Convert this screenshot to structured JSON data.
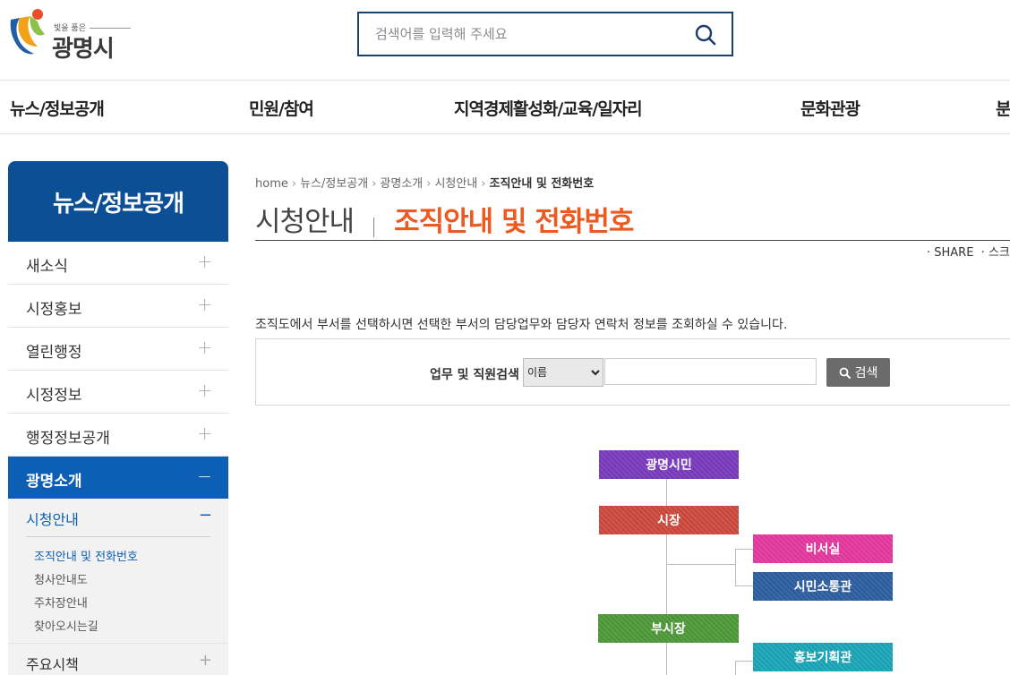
{
  "header": {
    "logo_tagline": "빛을 품은",
    "logo_name": "광명시",
    "search_placeholder": "검색어를 입력해 주세요"
  },
  "gnb": [
    "뉴스/정보공개",
    "민원/참여",
    "지역경제활성화/교육/일자리",
    "문화관광",
    "분"
  ],
  "sidebar": {
    "title": "뉴스/정보공개",
    "items": [
      {
        "label": "새소식",
        "sign": "+"
      },
      {
        "label": "시정홍보",
        "sign": "+"
      },
      {
        "label": "열린행정",
        "sign": "+"
      },
      {
        "label": "시정정보",
        "sign": "+"
      },
      {
        "label": "행정정보공개",
        "sign": "+"
      },
      {
        "label": "광명소개",
        "sign": "−"
      }
    ],
    "sub_head": {
      "label": "시청안내",
      "sign": "−"
    },
    "sub_links": [
      "조직안내 및 전화번호",
      "청사안내도",
      "주차장안내",
      "찾아오시는길"
    ],
    "last": {
      "label": "주요시책",
      "sign": "+"
    }
  },
  "breadcrumb": [
    "home",
    "뉴스/정보공개",
    "광명소개",
    "시청안내",
    "조직안내 및 전화번호"
  ],
  "page": {
    "parent": "시청안내",
    "title": "조직안내 및 전화번호",
    "share": "· SHARE",
    "share2": "· 스크"
  },
  "intro": "조직도에서 부서를 선택하시면 선택한 부서의 담당업무와 담당자 연락처 정보를 조회하실 수 있습니다.",
  "staff_search": {
    "label": "업무 및 직원검색",
    "select_value": "이름",
    "input_value": "",
    "button": "검색"
  },
  "org": {
    "citizen": "광명시민",
    "mayor": "시장",
    "secretary": "비서실",
    "communication": "시민소통관",
    "vice_mayor": "부시장",
    "pr_planning": "홍보기획관"
  },
  "colors": {
    "brand_blue": "#0d4f94",
    "active_blue": "#0d5fb5",
    "title_orange": "#ed5a1f",
    "org_citizen": "#7a3bbf",
    "org_mayor": "#cf4a3e",
    "org_secretary": "#e6389f",
    "org_communication": "#2d5fa3",
    "org_vice_mayor": "#4f9a3a",
    "org_pr_planning": "#1ba7b8"
  }
}
